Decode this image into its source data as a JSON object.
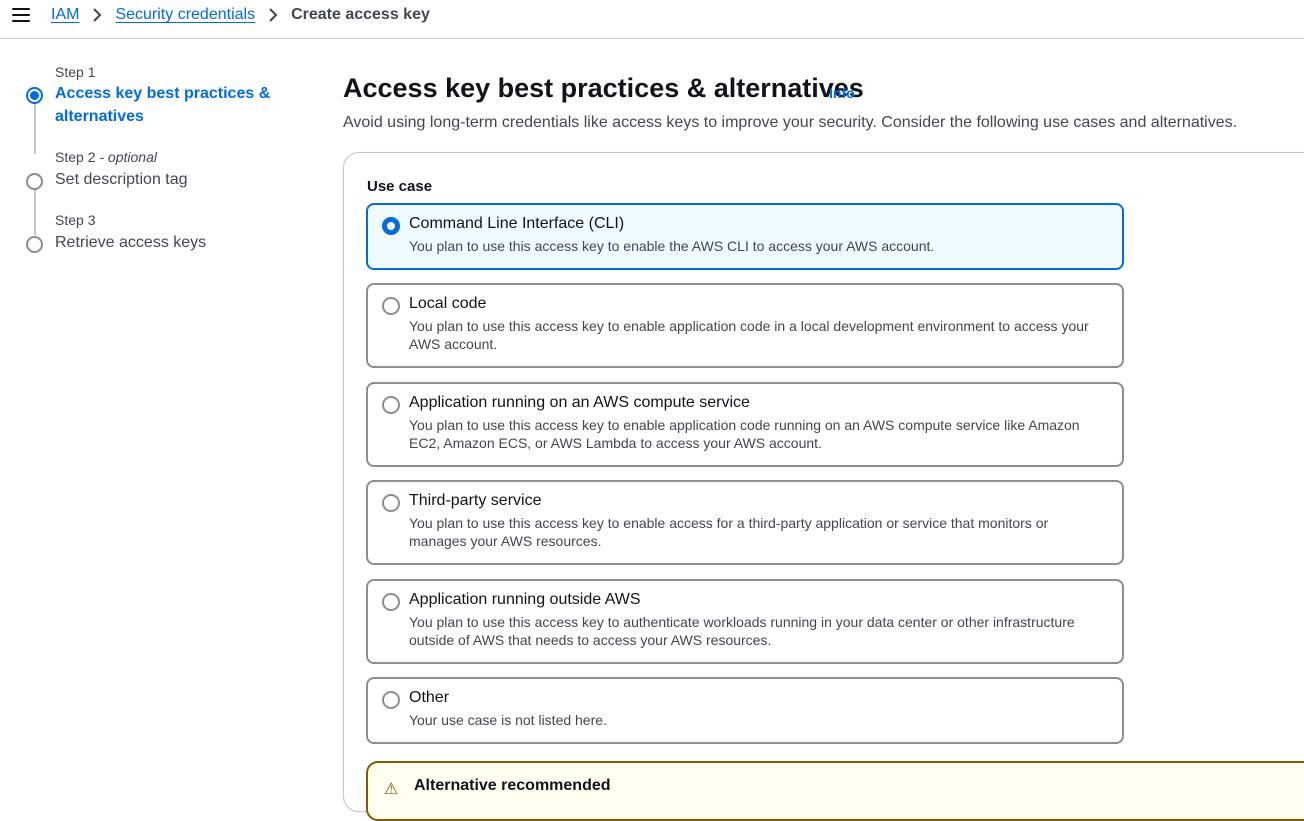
{
  "breadcrumb": {
    "items": [
      "IAM",
      "Security credentials"
    ],
    "current": "Create access key"
  },
  "steps": [
    {
      "label": "Step 1",
      "title": "Access key best practices & alternatives",
      "active": true
    },
    {
      "label": "Step 2",
      "label_suffix": " - optional",
      "title": "Set description tag",
      "active": false
    },
    {
      "label": "Step 3",
      "title": "Retrieve access keys",
      "active": false
    }
  ],
  "main": {
    "title": "Access key best practices & alternatives",
    "info_link": "Info",
    "description": "Avoid using long-term credentials like access keys to improve your security. Consider the following use cases and alternatives.",
    "use_case_label": "Use case",
    "options": [
      {
        "title": "Command Line Interface (CLI)",
        "description": "You plan to use this access key to enable the AWS CLI to access your AWS account.",
        "selected": true
      },
      {
        "title": "Local code",
        "description": "You plan to use this access key to enable application code in a local development environment to access your AWS account.",
        "selected": false
      },
      {
        "title": "Application running on an AWS compute service",
        "description": "You plan to use this access key to enable application code running on an AWS compute service like Amazon EC2, Amazon ECS, or AWS Lambda to access your AWS account.",
        "selected": false
      },
      {
        "title": "Third-party service",
        "description": "You plan to use this access key to enable access for a third-party application or service that monitors or manages your AWS resources.",
        "selected": false
      },
      {
        "title": "Application running outside AWS",
        "description": "You plan to use this access key to authenticate workloads running in your data center or other infrastructure outside of AWS that needs to access your AWS resources.",
        "selected": false
      },
      {
        "title": "Other",
        "description": "Your use case is not listed here.",
        "selected": false
      }
    ],
    "alert": {
      "title": "Alternative recommended",
      "icon": "warning-icon"
    }
  },
  "colors": {
    "accent": "#006ce0",
    "selected_bg": "#f0fbff",
    "border": "#8c8c94",
    "warning": "#855900"
  }
}
